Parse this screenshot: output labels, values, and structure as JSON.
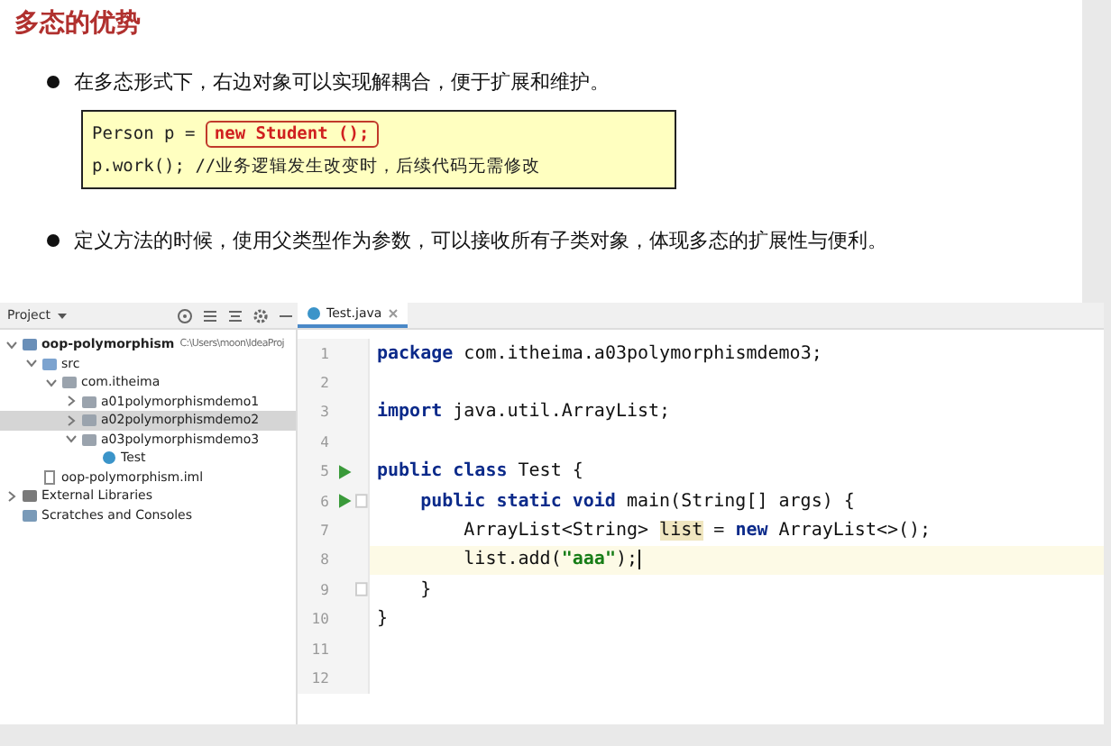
{
  "slide": {
    "title": "多态的优势",
    "bullets": [
      {
        "text": "在多态形式下，右边对象可以实现解耦合，便于扩展和维护。"
      },
      {
        "text": "定义方法的时候，使用父类型作为参数，可以接收所有子类对象，体现多态的扩展性与便利。"
      }
    ],
    "code_box": {
      "line_1": {
        "prefix": "Person p = ",
        "highlight": "new Student ();"
      },
      "line_2": "p.work(); //业务逻辑发生改变时，后续代码无需修改"
    }
  },
  "ide": {
    "project_panel": {
      "title": "Project",
      "tree": [
        {
          "kind": "module",
          "label": "oop-polymorphism",
          "path": "C:\\Users\\moon\\IdeaProj",
          "expanded": true,
          "selected": false,
          "children": [
            {
              "kind": "folder",
              "label": "src",
              "expanded": true,
              "selected": false,
              "children": [
                {
                  "kind": "package",
                  "label": "com.itheima",
                  "expanded": true,
                  "selected": false,
                  "children": [
                    {
                      "kind": "package",
                      "label": "a01polymorphismdemo1",
                      "expanded": false,
                      "selected": false
                    },
                    {
                      "kind": "package",
                      "label": "a02polymorphismdemo2",
                      "expanded": false,
                      "selected": true
                    },
                    {
                      "kind": "package",
                      "label": "a03polymorphismdemo3",
                      "expanded": true,
                      "selected": false,
                      "children": [
                        {
                          "kind": "class",
                          "label": "Test",
                          "selected": false
                        }
                      ]
                    }
                  ]
                }
              ]
            },
            {
              "kind": "file",
              "label": "oop-polymorphism.iml",
              "selected": false
            }
          ]
        },
        {
          "kind": "libraries",
          "label": "External Libraries",
          "expanded": false,
          "selected": false
        },
        {
          "kind": "scratches",
          "label": "Scratches and Consoles",
          "selected": false
        }
      ]
    },
    "tabs": [
      {
        "label": "Test.java",
        "selected": true
      }
    ],
    "lines": [
      {
        "number": "1",
        "segments": [
          {
            "text": "package",
            "kind": "keyword"
          },
          {
            "text": " com.itheima.a03polymorphismdemo3;",
            "kind": "plain"
          }
        ]
      },
      {
        "number": "2"
      },
      {
        "number": "3",
        "segments": [
          {
            "text": "import",
            "kind": "keyword"
          },
          {
            "text": " java.util.ArrayList;",
            "kind": "plain"
          }
        ]
      },
      {
        "number": "4"
      },
      {
        "number": "5",
        "run": true,
        "segments": [
          {
            "text": "public class",
            "kind": "keyword"
          },
          {
            "text": " Test {",
            "kind": "plain"
          }
        ]
      },
      {
        "number": "6",
        "run": true,
        "fold": true,
        "segments": [
          {
            "text": "    public static void",
            "kind": "keyword"
          },
          {
            "text": " main(String[] args) {",
            "kind": "plain"
          }
        ]
      },
      {
        "number": "7",
        "segments": [
          {
            "text": "        ArrayList<String> ",
            "kind": "plain"
          },
          {
            "text": "list",
            "kind": "usage"
          },
          {
            "text": " = ",
            "kind": "plain"
          },
          {
            "text": "new",
            "kind": "keyword"
          },
          {
            "text": " ArrayList<>();",
            "kind": "plain"
          }
        ]
      },
      {
        "number": "8",
        "current": true,
        "segments": [
          {
            "text": "        list.add(",
            "kind": "plain"
          },
          {
            "text": "\"aaa\"",
            "kind": "string"
          },
          {
            "text": ");",
            "kind": "plain"
          }
        ]
      },
      {
        "number": "9",
        "fold": true,
        "segments": [
          {
            "text": "    }",
            "kind": "plain"
          }
        ]
      },
      {
        "number": "10",
        "segments": [
          {
            "text": "}",
            "kind": "plain"
          }
        ]
      },
      {
        "number": "11"
      },
      {
        "number": "12"
      }
    ]
  }
}
